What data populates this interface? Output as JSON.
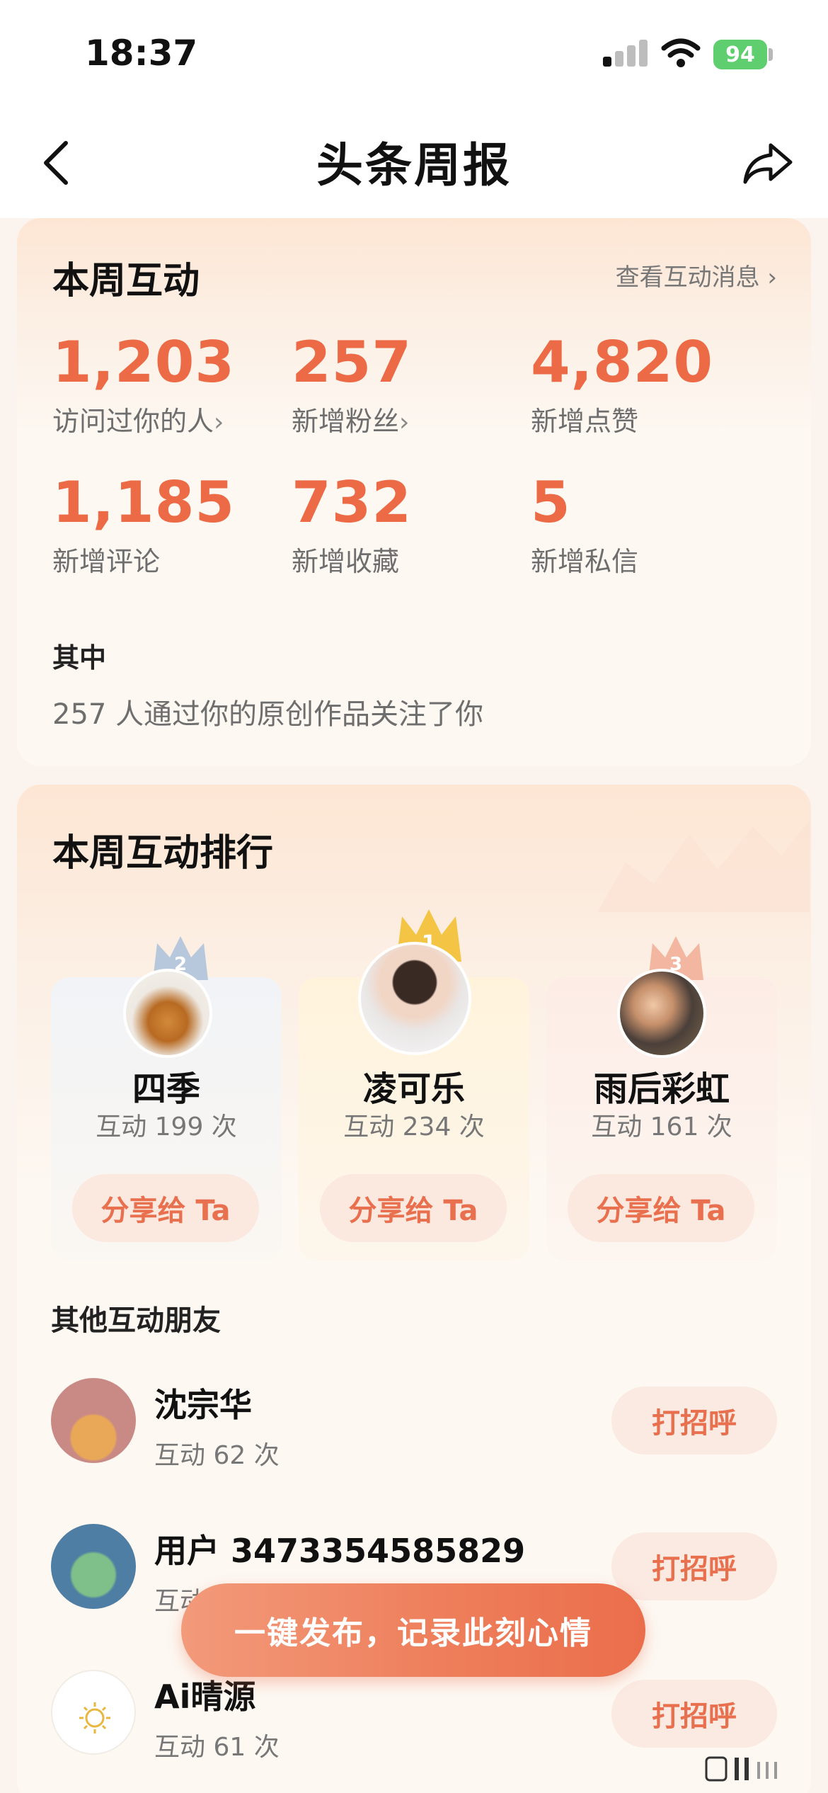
{
  "status_bar": {
    "time": "18:37",
    "battery": "94"
  },
  "nav": {
    "title": "头条周报"
  },
  "weekly": {
    "title": "本周互动",
    "link": "查看互动消息 ›",
    "stats": [
      {
        "value": "1,203",
        "label": "访问过你的人",
        "chevron": "›"
      },
      {
        "value": "257",
        "label": "新增粉丝",
        "chevron": "›"
      },
      {
        "value": "4,820",
        "label": "新增点赞",
        "chevron": ""
      },
      {
        "value": "1,185",
        "label": "新增评论",
        "chevron": ""
      },
      {
        "value": "732",
        "label": "新增收藏",
        "chevron": ""
      },
      {
        "value": "5",
        "label": "新增私信",
        "chevron": ""
      }
    ],
    "sub_title": "其中",
    "sub_text": "257 人通过你的原创作品关注了你"
  },
  "ranking": {
    "title": "本周互动排行",
    "top": [
      {
        "rank": "2",
        "name": "四季",
        "count": "互动 199 次",
        "share": "分享给 Ta"
      },
      {
        "rank": "1",
        "name": "凌可乐",
        "count": "互动 234 次",
        "share": "分享给 Ta"
      },
      {
        "rank": "3",
        "name": "雨后彩虹",
        "count": "互动 161 次",
        "share": "分享给 Ta"
      }
    ],
    "others_label": "其他互动朋友",
    "others": [
      {
        "name": "沈宗华",
        "count": "互动 62 次",
        "action": "打招呼"
      },
      {
        "name": "用户 3473354585829",
        "count": "互动",
        "action": "打招呼"
      },
      {
        "name": "Ai晴源",
        "count": "互动 61 次",
        "action": "打招呼"
      }
    ]
  },
  "fab": {
    "label": "一键发布，记录此刻心情"
  },
  "colors": {
    "accent": "#ec6a45",
    "pill_bg": "#fbe8df"
  }
}
